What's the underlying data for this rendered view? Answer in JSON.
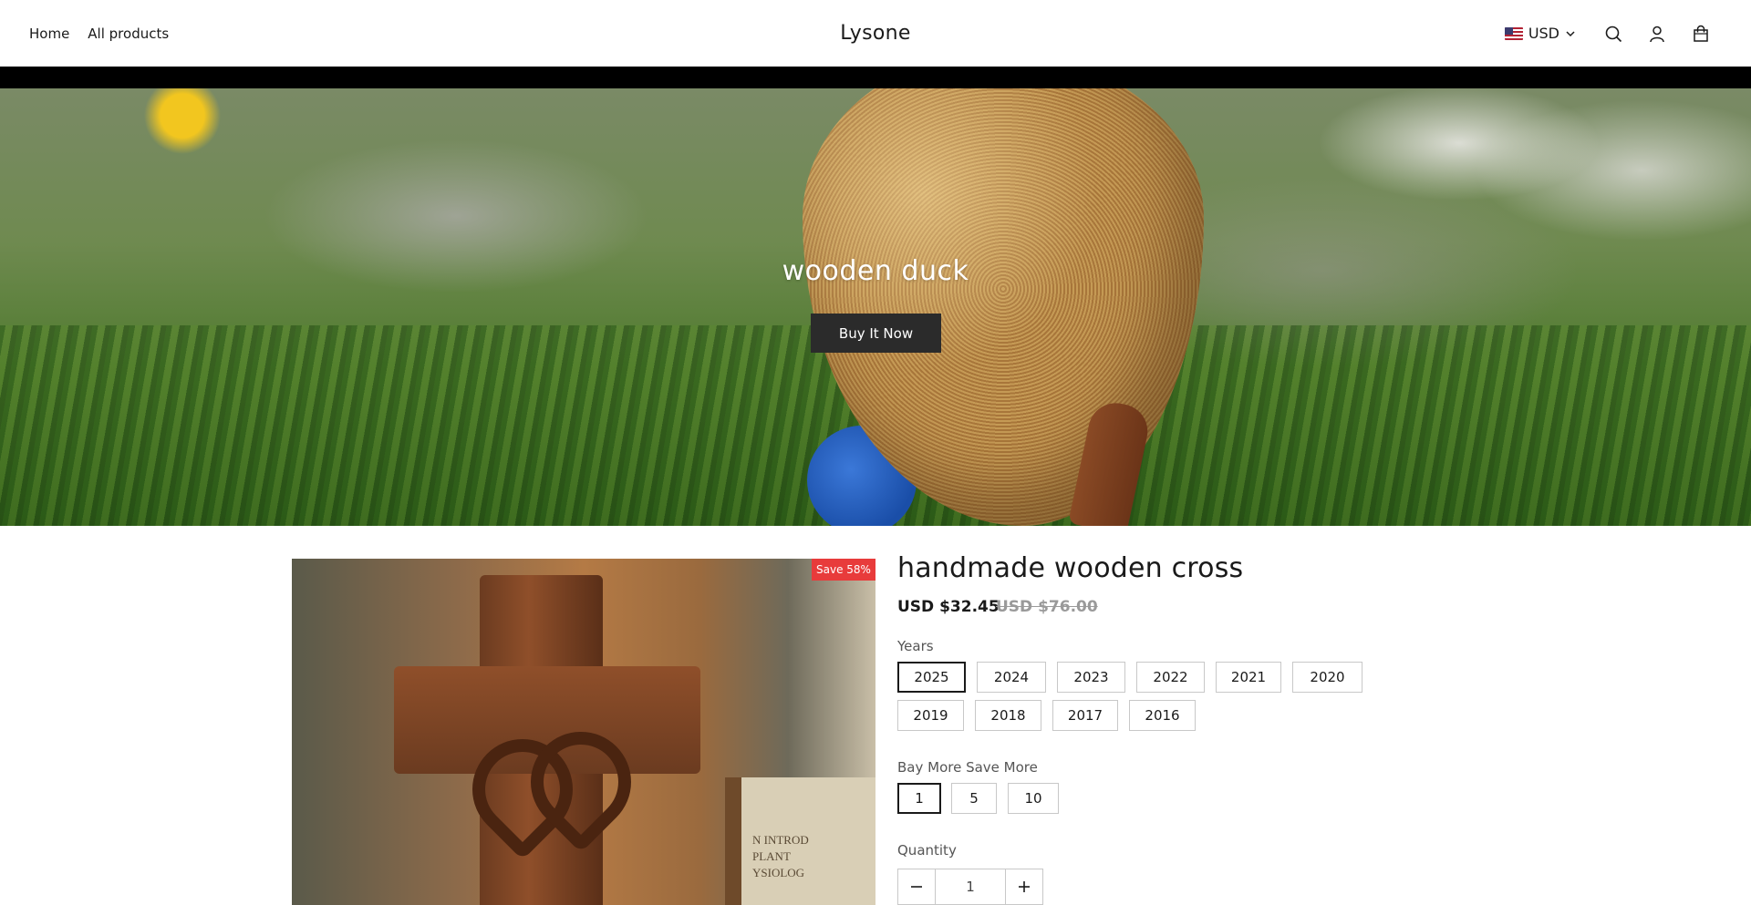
{
  "header": {
    "nav": [
      {
        "label": "Home"
      },
      {
        "label": "All products"
      }
    ],
    "logo": "Lysone",
    "currency": "USD",
    "icons": [
      "search-icon",
      "account-icon",
      "cart-icon"
    ]
  },
  "hero": {
    "title": "wooden duck",
    "button": "Buy It Now"
  },
  "product": {
    "badge": "Save 58%",
    "title": "handmade wooden cross",
    "price": "USD $32.45",
    "compare_price": "USD $76.00",
    "image_text": [
      "N INTROD",
      "PLANT",
      "YSIOLOG"
    ],
    "years": {
      "label": "Years",
      "options": [
        "2025",
        "2024",
        "2023",
        "2022",
        "2021",
        "2020",
        "2019",
        "2018",
        "2017",
        "2016"
      ],
      "selected": "2025"
    },
    "bundle": {
      "label": "Bay More Save More",
      "options": [
        "1",
        "5",
        "10"
      ],
      "selected": "1"
    },
    "quantity": {
      "label": "Quantity",
      "value": "1"
    }
  },
  "colors": {
    "badge": "#e83b3b",
    "button": "#2b2b2b",
    "strip": "#000000"
  }
}
